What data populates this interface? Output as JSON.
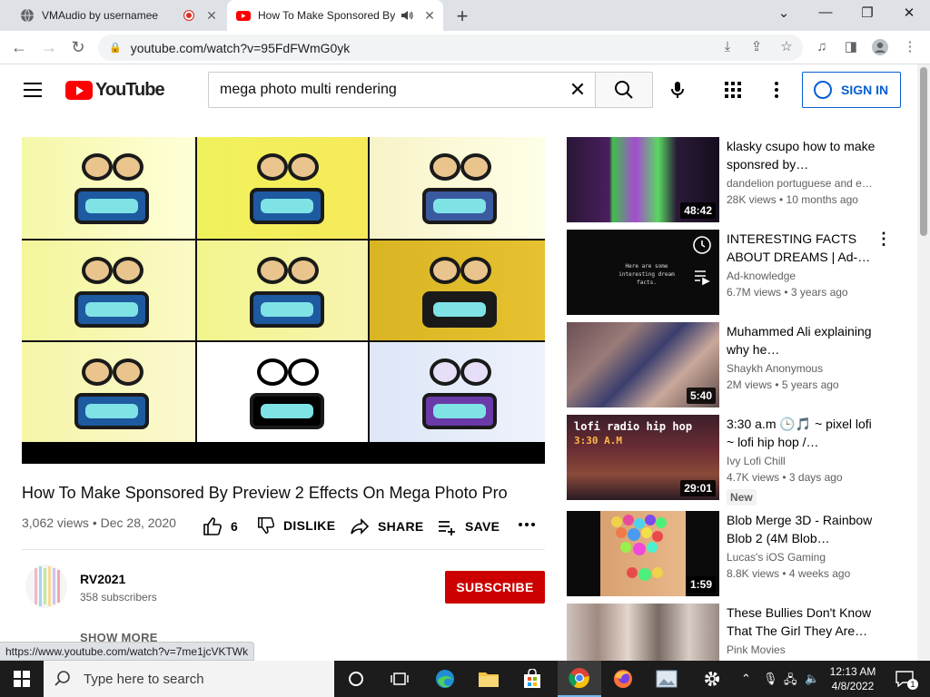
{
  "browser": {
    "tabs": [
      {
        "title": "VMAudio by usernamee",
        "active": false
      },
      {
        "title": "How To Make Sponsored By",
        "active": true
      }
    ],
    "url": "youtube.com/watch?v=95FdFWmG0yk",
    "status_url": "https://www.youtube.com/watch?v=7me1jcVKTWk"
  },
  "yt_header": {
    "logo_text": "YouTube",
    "search_value": "mega photo multi rendering",
    "signin_label": "SIGN IN"
  },
  "video": {
    "title": "How To Make Sponsored By Preview 2 Effects On Mega Photo Pro",
    "views": "3,062 views",
    "date": "Dec 28, 2020",
    "meta_sep": " • ",
    "likes": "6",
    "dislike_label": "DISLIKE",
    "share_label": "SHARE",
    "save_label": "SAVE",
    "channel_name": "RV2021",
    "subscribers": "358 subscribers",
    "subscribe_label": "SUBSCRIBE",
    "show_more_label": "SHOW MORE"
  },
  "recommendations": [
    {
      "title": "klasky csupo how to make sponsred by…",
      "channel": "dandelion portuguese and e…",
      "meta": "28K views • 10 months ago",
      "duration": "48:42"
    },
    {
      "title": "INTERESTING FACTS ABOUT DREAMS | Ad-…",
      "channel": "Ad-knowledge",
      "meta": "6.7M views • 3 years ago",
      "duration": "",
      "thumb_caption": "Here are some interesting dream facts."
    },
    {
      "title": "Muhammed Ali explaining why he…",
      "channel": "Shaykh Anonymous",
      "meta": "2M views • 5 years ago",
      "duration": "5:40"
    },
    {
      "title": "3:30 a.m 🕒🎵 ~ pixel lofi ~ lofi hip hop /…",
      "channel": "Ivy Lofi Chill",
      "meta": "4.7K views • 3 days ago",
      "duration": "29:01",
      "badge": "New",
      "thumb_caption": "lofi radio hip hop",
      "thumb_time": "3:30 A.M"
    },
    {
      "title": "Blob Merge 3D - Rainbow Blob 2 (4M Blob…",
      "channel": "Lucas's iOS Gaming",
      "meta": "8.8K views • 4 weeks ago",
      "duration": "1:59"
    },
    {
      "title": "These Bullies Don't Know That The Girl They Are…",
      "channel": "Pink Movies",
      "meta": "",
      "duration": ""
    }
  ],
  "taskbar": {
    "search_placeholder": "Type here to search",
    "time": "12:13 AM",
    "date": "4/8/2022",
    "notification_count": "1"
  },
  "colors": {
    "yt_red": "#ff0000",
    "subscribe_red": "#cc0000",
    "signin_blue": "#065fd4",
    "taskbar": "#1c1c1c"
  }
}
